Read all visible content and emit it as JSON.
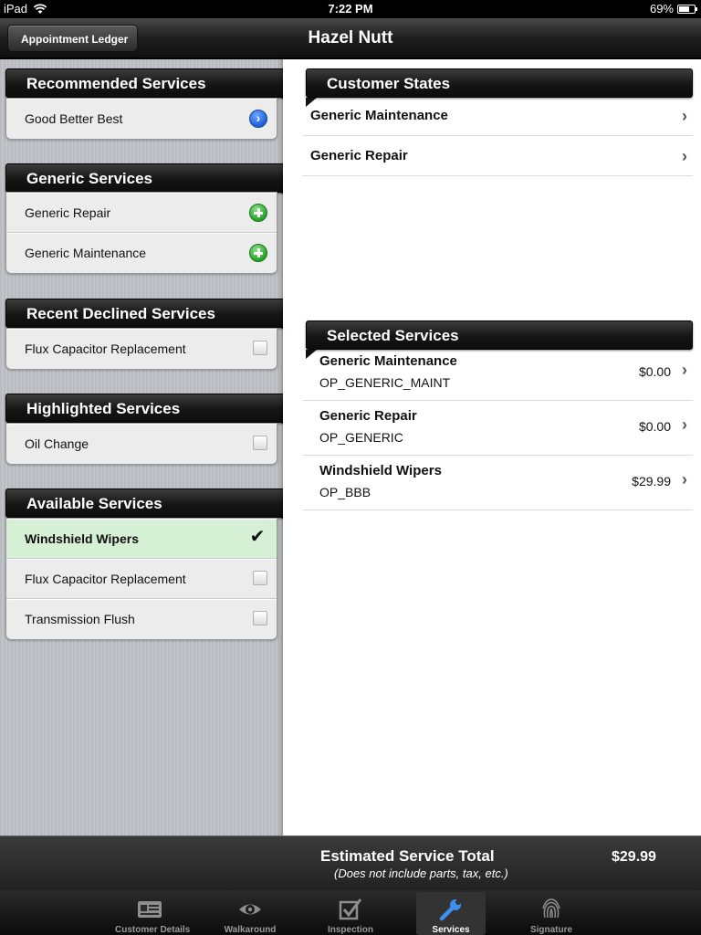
{
  "status_bar": {
    "device": "iPad",
    "time": "7:22 PM",
    "battery": "69%",
    "battery_level": 0.69
  },
  "nav": {
    "back_label": "Appointment Ledger",
    "title": "Hazel Nutt"
  },
  "left_sections": {
    "recommended": {
      "title": "Recommended Services",
      "items": [
        {
          "label": "Good Better Best"
        }
      ]
    },
    "generic": {
      "title": "Generic Services",
      "items": [
        {
          "label": "Generic Repair"
        },
        {
          "label": "Generic Maintenance"
        }
      ]
    },
    "declined": {
      "title": "Recent Declined Services",
      "items": [
        {
          "label": "Flux Capacitor Replacement",
          "checked": false
        }
      ]
    },
    "highlighted": {
      "title": "Highlighted Services",
      "items": [
        {
          "label": "Oil Change",
          "checked": false
        }
      ]
    },
    "available": {
      "title": "Available Services",
      "items": [
        {
          "label": "Windshield Wipers",
          "checked": true
        },
        {
          "label": "Flux Capacitor Replacement",
          "checked": false
        },
        {
          "label": "Transmission Flush",
          "checked": false
        }
      ]
    }
  },
  "customer_states": {
    "title": "Customer States",
    "items": [
      {
        "label": "Generic Maintenance"
      },
      {
        "label": "Generic Repair"
      }
    ]
  },
  "selected_services": {
    "title": "Selected Services",
    "items": [
      {
        "name": "Generic Maintenance",
        "code": "OP_GENERIC_MAINT",
        "price": "$0.00"
      },
      {
        "name": "Generic Repair",
        "code": "OP_GENERIC",
        "price": "$0.00"
      },
      {
        "name": "Windshield Wipers",
        "code": "OP_BBB",
        "price": "$29.99"
      }
    ]
  },
  "totals": {
    "label": "Estimated Service Total",
    "note": "(Does not include parts, tax, etc.)",
    "value": "$29.99"
  },
  "tabs": [
    {
      "label": "Customer Details",
      "icon": "id-card-icon"
    },
    {
      "label": "Walkaround",
      "icon": "eye-icon"
    },
    {
      "label": "Inspection",
      "icon": "checkbox-icon"
    },
    {
      "label": "Services",
      "icon": "wrench-icon",
      "active": true
    },
    {
      "label": "Signature",
      "icon": "fingerprint-icon"
    }
  ],
  "colors": {
    "selected_row": "#d5f0d5",
    "disclosure_blue": "#1f5fd6",
    "add_green": "#25a325",
    "active_tab_icon": "#3d8ff2"
  }
}
